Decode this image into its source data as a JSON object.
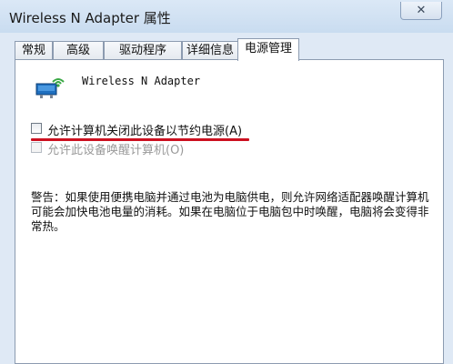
{
  "window": {
    "title": "Wireless N Adapter 属性"
  },
  "controls": {
    "close_symbol": "✕"
  },
  "tabs": [
    {
      "label": "常规",
      "active": false
    },
    {
      "label": "高级",
      "active": false
    },
    {
      "label": "驱动程序",
      "active": false
    },
    {
      "label": "详细信息",
      "active": false
    },
    {
      "label": "电源管理",
      "active": true
    }
  ],
  "device": {
    "name": "Wireless N Adapter",
    "icon": "network-adapter-icon"
  },
  "options": [
    {
      "label": "允许计算机关闭此设备以节约电源(A)",
      "checked": false,
      "enabled": true
    },
    {
      "label": "允许此设备唤醒计算机(O)",
      "checked": false,
      "enabled": false
    }
  ],
  "warning": "警告：如果使用便携电脑并通过电池为电脑供电，则允许网络适配器唤醒计算机可能会加快电池电量的消耗。如果在电脑位于电脑包中时唤醒，电脑将会变得非常热。",
  "colors": {
    "highlight": "#cc1020",
    "titlebar": "#d3e3f4"
  }
}
